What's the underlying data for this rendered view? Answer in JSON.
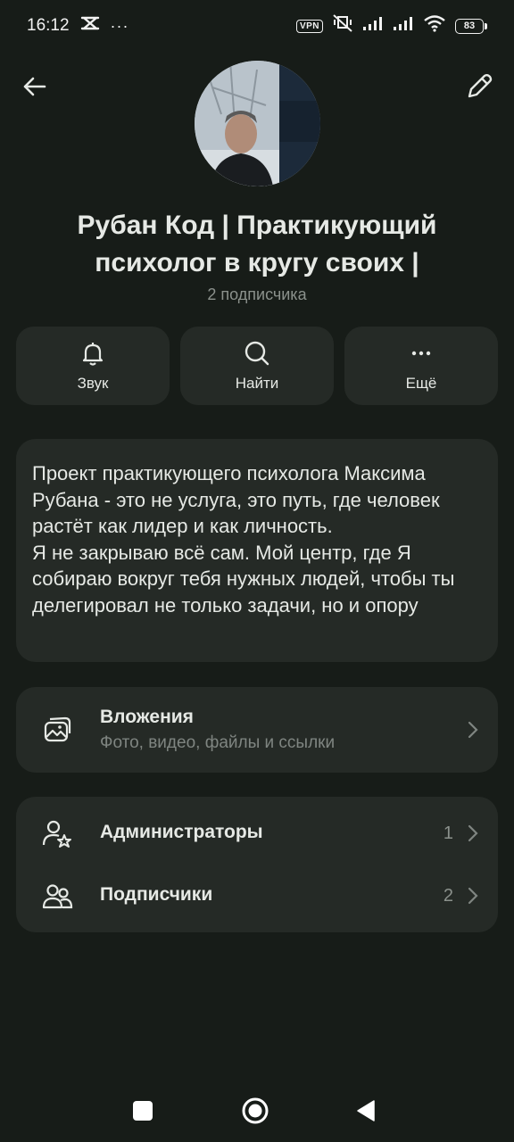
{
  "status_bar": {
    "time": "16:12",
    "ellipsis": "···",
    "vpn_label": "VPN",
    "battery_level": "83"
  },
  "channel": {
    "title": "Рубан Код | Практикующий психолог в кругу своих |",
    "subscribers_text": "2 подписчика"
  },
  "actions": [
    {
      "label": "Звук",
      "icon": "bell-icon"
    },
    {
      "label": "Найти",
      "icon": "search-icon"
    },
    {
      "label": "Ещё",
      "icon": "more-icon"
    }
  ],
  "description": "Проект практикующего психолога Максима Рубана  -  это не услуга, это путь, где человек растёт как лидер и как личность.\nЯ не закрываю всё сам. Мой центр, где Я собираю вокруг тебя нужных людей, чтобы ты делегировал не только задачи, но и опору",
  "attachments": {
    "title": "Вложения",
    "subtitle": "Фото, видео, файлы и ссылки"
  },
  "members": [
    {
      "label": "Администраторы",
      "count": "1",
      "icon": "admin-star-icon"
    },
    {
      "label": "Подписчики",
      "count": "2",
      "icon": "people-icon"
    }
  ],
  "colors": {
    "background": "#171c18",
    "card": "#252a26",
    "text": "#e6e9e5",
    "muted": "#8b918c"
  }
}
